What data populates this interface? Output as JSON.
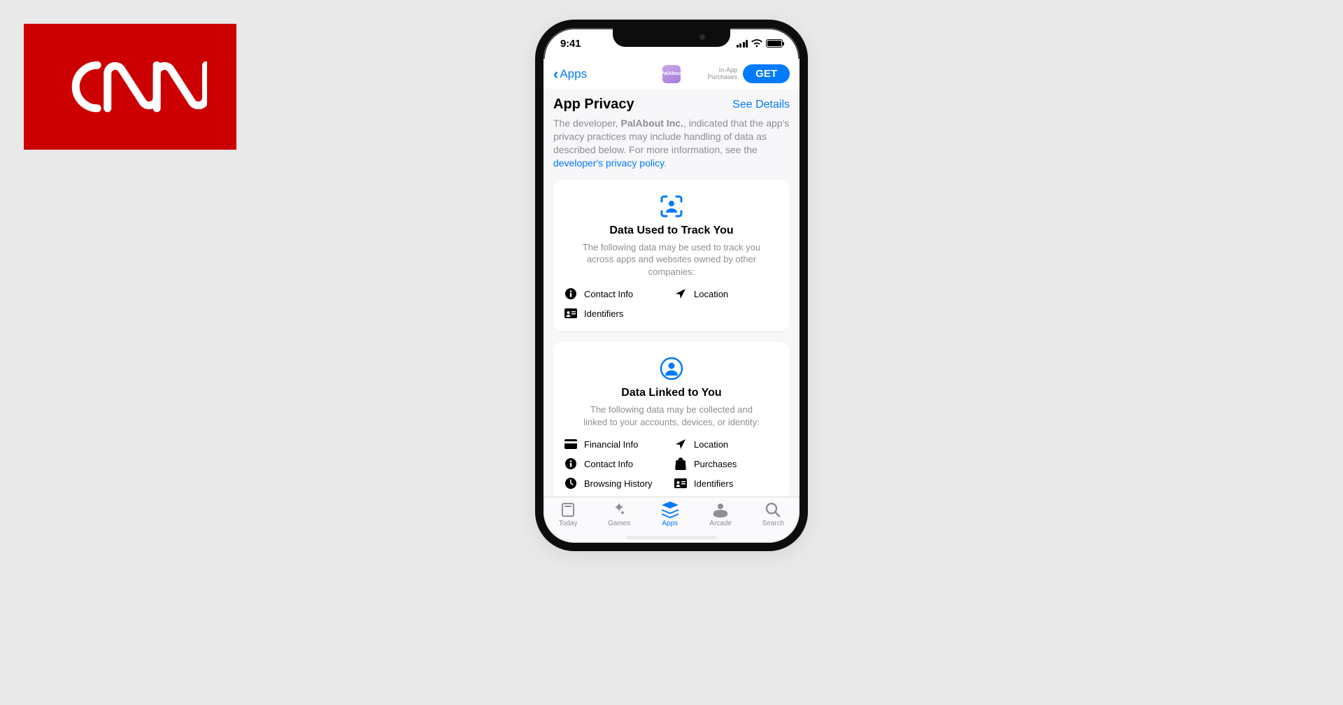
{
  "logo": {
    "text": "CNN"
  },
  "status": {
    "time": "9:41"
  },
  "nav": {
    "back_label": "Apps",
    "app_icon_text": "PalAbout",
    "iap_line1": "In-App",
    "iap_line2": "Purchases",
    "get_label": "GET"
  },
  "privacy": {
    "title": "App Privacy",
    "see_details": "See Details",
    "desc_prefix": "The developer, ",
    "developer": "PalAbout Inc.",
    "desc_mid": ", indicated that the app's privacy practices may include handling of data as described below. For more information, see the ",
    "link_text": "developer's privacy policy",
    "desc_suffix": "."
  },
  "card1": {
    "title": "Data Used to Track You",
    "desc": "The following data may be used to track you across apps and websites owned by other companies:",
    "items": [
      {
        "icon": "info",
        "label": "Contact Info"
      },
      {
        "icon": "nav",
        "label": "Location"
      },
      {
        "icon": "idcard",
        "label": "Identifiers"
      }
    ]
  },
  "card2": {
    "title": "Data Linked to You",
    "desc": "The following data may be collected and linked to your accounts, devices, or identity:",
    "items": [
      {
        "icon": "card",
        "label": "Financial Info"
      },
      {
        "icon": "nav",
        "label": "Location"
      },
      {
        "icon": "info",
        "label": "Contact Info"
      },
      {
        "icon": "bag",
        "label": "Purchases"
      },
      {
        "icon": "clock",
        "label": "Browsing History"
      },
      {
        "icon": "idcard",
        "label": "Identifiers"
      }
    ]
  },
  "tabs": [
    {
      "label": "Today",
      "icon": "today",
      "active": false
    },
    {
      "label": "Games",
      "icon": "games",
      "active": false
    },
    {
      "label": "Apps",
      "icon": "apps",
      "active": true
    },
    {
      "label": "Arcade",
      "icon": "arcade",
      "active": false
    },
    {
      "label": "Search",
      "icon": "search",
      "active": false
    }
  ],
  "colors": {
    "accent": "#007aff",
    "cnn": "#cc0000"
  }
}
